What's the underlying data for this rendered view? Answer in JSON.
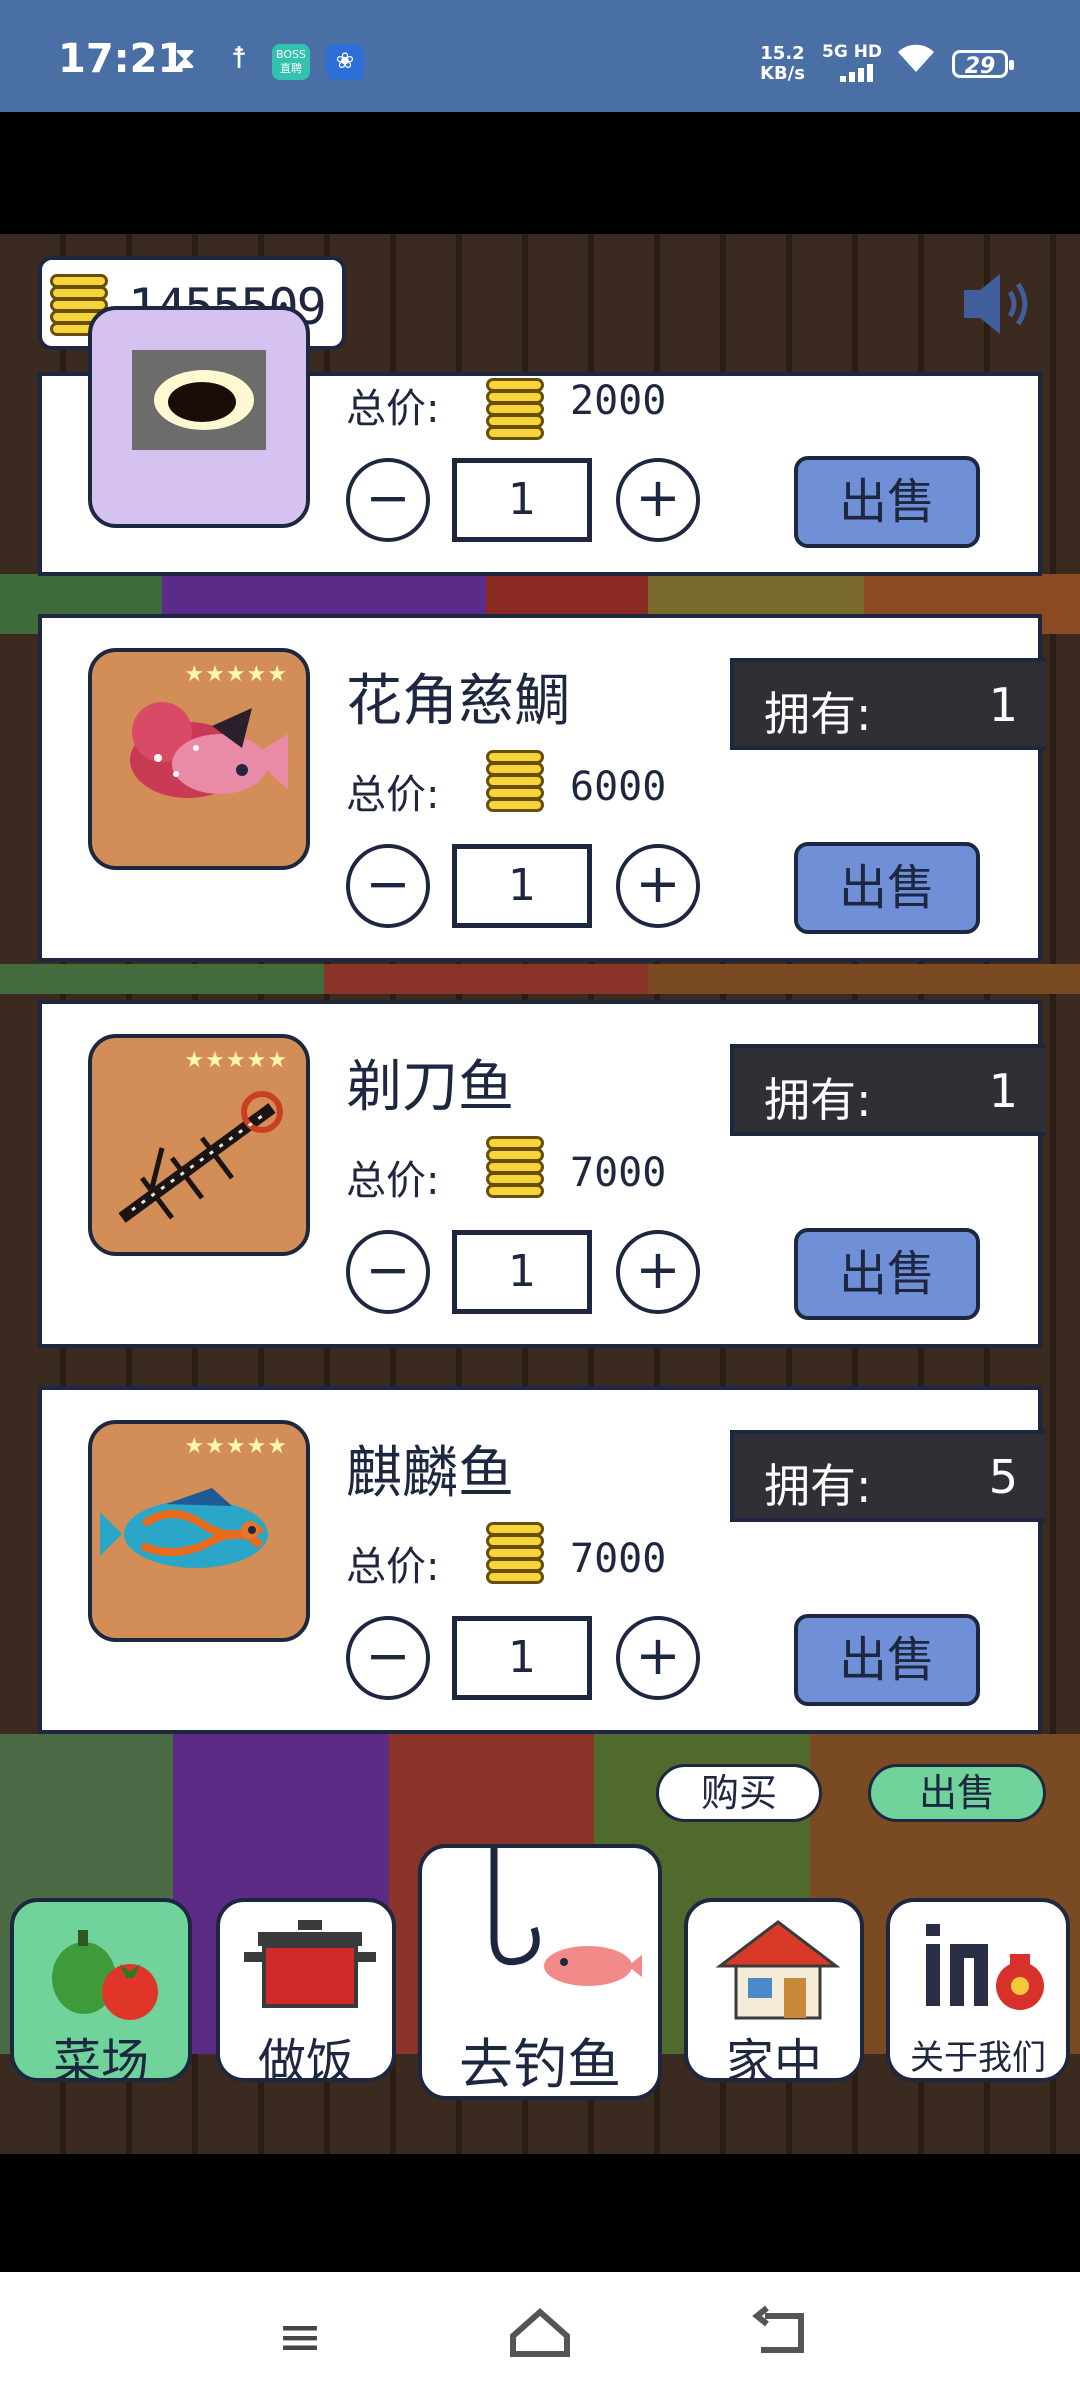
{
  "status_bar": {
    "time": "17:21",
    "boss_label": "BOSS\n直聘",
    "speed": "15.2\nKB/s",
    "network": "5G HD",
    "battery": "29"
  },
  "wallet": {
    "coins": "1455509"
  },
  "fish_list": [
    {
      "name": "",
      "price_label": "总价:",
      "price": "2000",
      "quantity": "1",
      "sell_label": "出售"
    },
    {
      "name": "花角慈鯛",
      "stars": "★★★★★",
      "owned_label": "拥有:",
      "owned": "1",
      "price_label": "总价:",
      "price": "6000",
      "quantity": "1",
      "sell_label": "出售"
    },
    {
      "name": "剃刀鱼",
      "stars": "★★★★★",
      "owned_label": "拥有:",
      "owned": "1",
      "price_label": "总价:",
      "price": "7000",
      "quantity": "1",
      "sell_label": "出售"
    },
    {
      "name": "麒麟鱼",
      "stars": "★★★★★",
      "owned_label": "拥有:",
      "owned": "5",
      "price_label": "总价:",
      "price": "7000",
      "quantity": "1",
      "sell_label": "出售"
    }
  ],
  "controls": {
    "minus": "−",
    "plus": "+"
  },
  "tabs": {
    "buy": "购买",
    "sell": "出售"
  },
  "nav": {
    "market": "菜场",
    "cook": "做饭",
    "fishing": "去钓鱼",
    "home": "家中",
    "about": "关于我们"
  },
  "colors": {
    "accent": "#6f8fd6",
    "outline": "#1d2740",
    "status_bar": "#4a6fa5",
    "market_bg": "#6fd39b"
  }
}
